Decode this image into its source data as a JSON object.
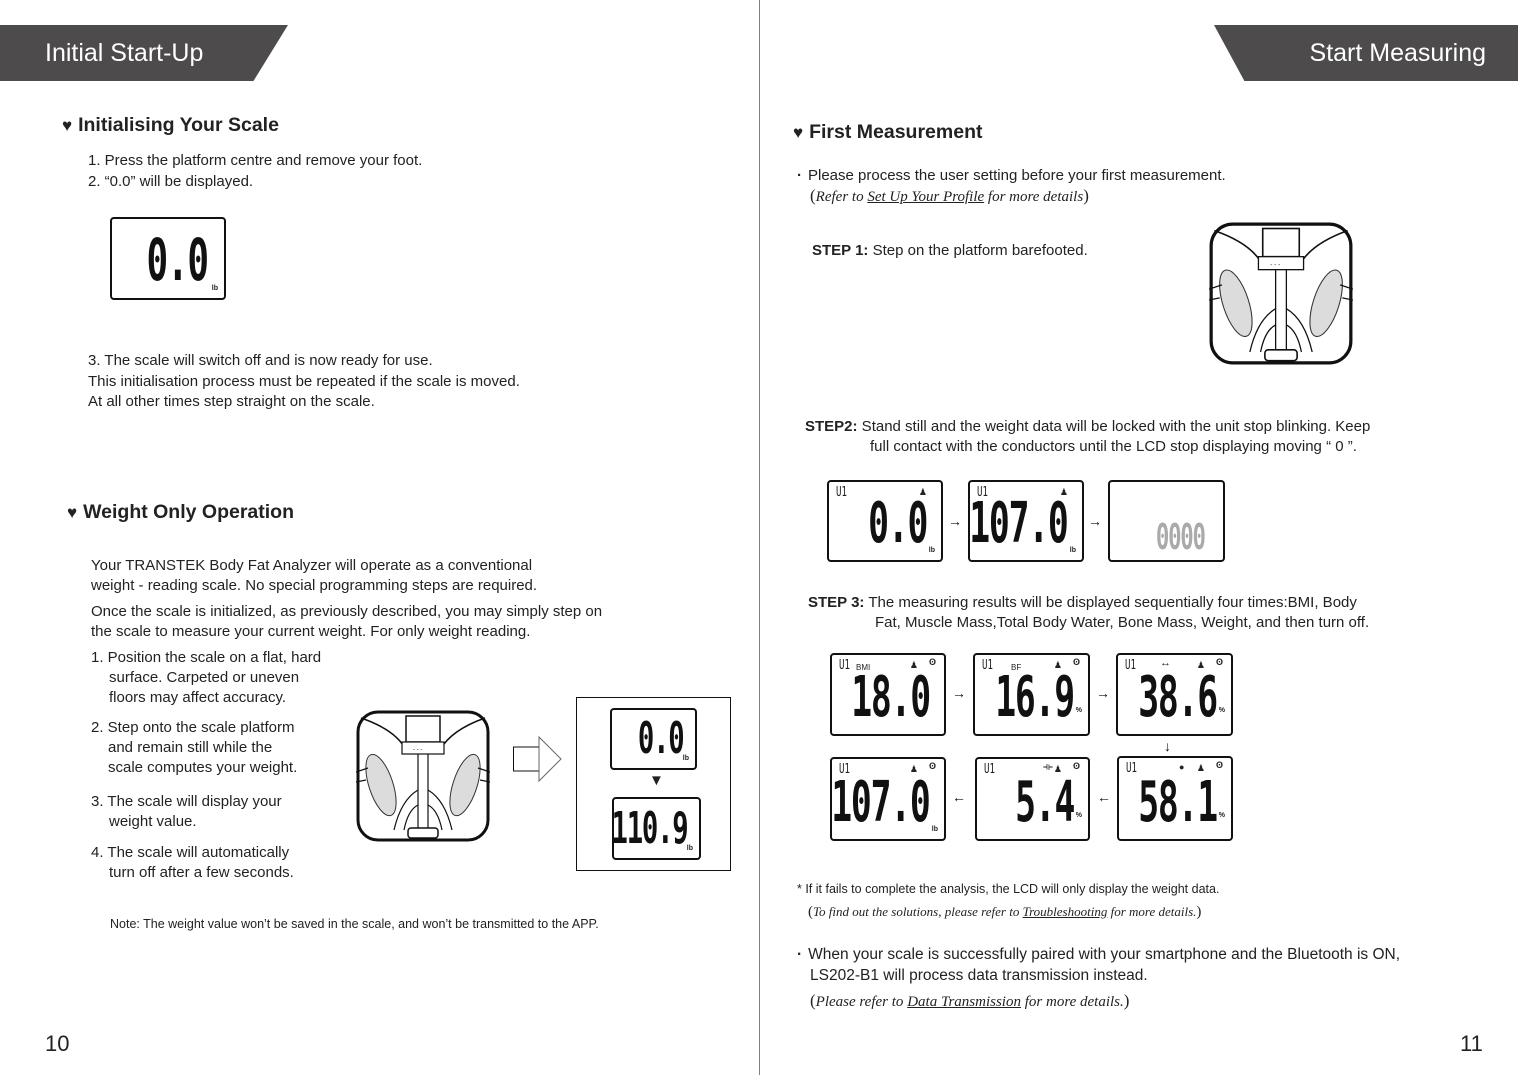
{
  "left_page": {
    "banner": "Initial Start-Up",
    "page_number": "10",
    "init_section": {
      "title": "Initialising Your Scale",
      "steps": [
        "1. Press the platform centre and remove your foot.",
        "2. “0.0” will be displayed."
      ],
      "lcd_value": "0.0",
      "lcd_unit": "lb",
      "after_lines": [
        "3. The scale will switch off and is now ready for use.",
        "This initialisation process must be repeated if the scale is moved.",
        "At all other times step straight on the scale."
      ]
    },
    "weight_section": {
      "title": "Weight Only Operation",
      "intro": [
        "Your TRANSTEK  Body Fat Analyzer will operate as a conventional",
        "weight - reading scale. No special programming steps are required."
      ],
      "intro2": [
        "Once the scale is initialized, as previously described, you may simply step on",
        "the scale to measure your current weight. For only weight reading."
      ],
      "steps": [
        [
          "1. Position the scale on a flat, hard",
          "surface. Carpeted or uneven",
          "floors may affect accuracy."
        ],
        [
          "2. Step onto the scale platform",
          "and remain still while the",
          "scale computes your weight."
        ],
        [
          "3. The scale will display your",
          "weight value."
        ],
        [
          "4. The scale will automatically",
          "turn off after a few seconds."
        ]
      ],
      "lcd_before": "0.0",
      "lcd_after": "110.9",
      "lcd_unit": "lb",
      "note": "Note:  The weight value won’t be saved in the scale, and won’t be transmitted to the APP."
    }
  },
  "right_page": {
    "banner": "Start Measuring",
    "page_number": "11",
    "first_measurement": {
      "title": "First Measurement",
      "bullet1": "Please process the user setting before your first measurement.",
      "ref1_prefix": "Refer to ",
      "ref1_link": "Set Up Your Profile",
      "ref1_suffix": " for more details",
      "step1_label": "STEP 1:",
      "step1_text": " Step on the platform barefooted.",
      "step2_label": "STEP2:",
      "step2_line1": " Stand still and the weight data will be locked with the unit stop blinking. Keep",
      "step2_line2": "full contact with the conductors until the LCD stop displaying moving “ 0 ”.",
      "step2_lcds": [
        {
          "user": "U1",
          "value": "0.0",
          "unit": "lb"
        },
        {
          "user": "U1",
          "value": "107.0",
          "unit": "lb"
        },
        {
          "user": "",
          "value": "0000",
          "unit": ""
        }
      ],
      "step3_label": "STEP 3:",
      "step3_line1": " The measuring results will be displayed sequentially four times:BMI, Body",
      "step3_line2": "Fat, Muscle Mass,Total Body Water, Bone Mass, Weight, and then turn off.",
      "results": [
        {
          "user": "U1",
          "label": "BMI",
          "value": "18.0",
          "unit": ""
        },
        {
          "user": "U1",
          "label": "BF",
          "value": "16.9",
          "unit": "%"
        },
        {
          "user": "U1",
          "label": "↔",
          "value": "38.6",
          "unit": "%"
        },
        {
          "user": "U1",
          "label": "●",
          "value": "58.1",
          "unit": "%"
        },
        {
          "user": "U1",
          "label": "⟛",
          "value": "5.4",
          "unit": "%"
        },
        {
          "user": "U1",
          "label": "",
          "value": "107.0",
          "unit": "lb"
        }
      ],
      "fail_note": "* If it fails to complete the analysis, the LCD will only display the weight data.",
      "ref2_prefix": "To find out the solutions, please refer to ",
      "ref2_link": "Troubleshooting",
      "ref2_suffix": " for more details.",
      "bullet2_line1": "When your scale is successfully paired with your smartphone and the Bluetooth is ON,",
      "bullet2_line2": "LS202-B1 will process data transmission instead.",
      "ref3_prefix": "Please refer to ",
      "ref3_link": "Data Transmission",
      "ref3_suffix": " for more details."
    }
  },
  "symbols": {
    "heart": "♥",
    "bullet": "·",
    "arrow_right": "→",
    "arrow_left": "←",
    "arrow_down": "↓",
    "triangle_down": "▼",
    "person": "♟",
    "bluetooth": "ʘ",
    "paren_open": "(",
    "paren_close": ")"
  },
  "colors": {
    "banner_bg": "#4d4b4c",
    "divider": "#d94f93"
  }
}
